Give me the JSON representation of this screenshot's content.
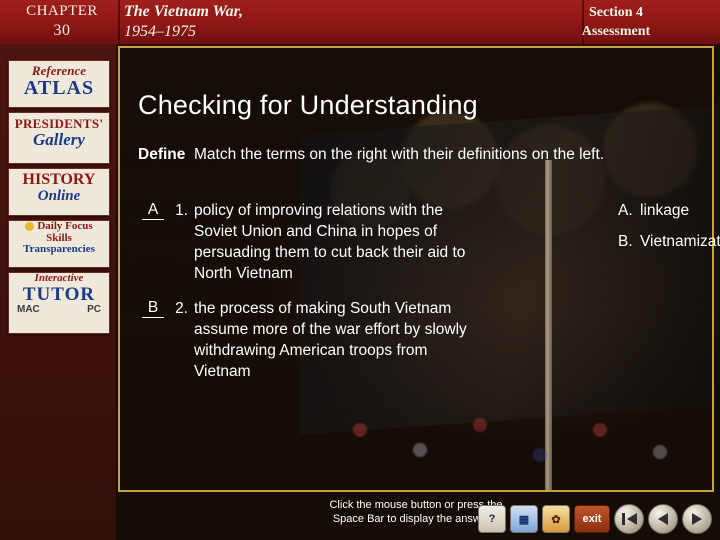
{
  "header": {
    "chapter_label": "CHAPTER",
    "chapter_number": "30",
    "title_line1": "The Vietnam War,",
    "title_line2": "1954–1975",
    "section_line1": "Section 4",
    "section_line2": "Assessment"
  },
  "sidebar": {
    "items": [
      {
        "line1": "Reference",
        "line2": "ATLAS"
      },
      {
        "line1": "PRESIDENTS'",
        "line2": "Gallery"
      },
      {
        "line1": "HISTORY",
        "line2": "Online"
      },
      {
        "line1": "Daily Focus",
        "line2": "Skills",
        "line3": "Transparencies"
      },
      {
        "line1": "Interactive",
        "line2": "TUTOR",
        "line3": "MAC",
        "line4": "PC"
      }
    ]
  },
  "main": {
    "page_title": "Checking for Understanding",
    "directions_label": "Define",
    "directions_text": "Match the terms on the right with their definitions on the left.",
    "questions": [
      {
        "answer": "A",
        "number": "1.",
        "text": "policy of improving relations with the Soviet Union and China in hopes of persuading them to cut back their aid to North Vietnam"
      },
      {
        "answer": "B",
        "number": "2.",
        "text": "the process of making South Vietnam assume more of the war effort by slowly withdrawing American troops from Vietnam"
      }
    ],
    "choices": [
      {
        "letter": "A.",
        "term": "linkage"
      },
      {
        "letter": "B.",
        "term": "Vietnamization"
      }
    ],
    "footer_line1": "Click the mouse button or press the",
    "footer_line2": "Space Bar to display the answers."
  },
  "navbar": {
    "buttons": [
      {
        "name": "help-icon",
        "label": "?"
      },
      {
        "name": "chart-icon",
        "label": "▦"
      },
      {
        "name": "gallery-icon",
        "label": "✿"
      },
      {
        "name": "exit-button",
        "label": "exit"
      },
      {
        "name": "previous-button",
        "label": "◀"
      },
      {
        "name": "back-button",
        "label": "◀"
      },
      {
        "name": "next-button",
        "label": "▶"
      }
    ]
  },
  "colors": {
    "header_red": "#8d1714",
    "gold_border": "#c9a23c",
    "text_white": "#ffffff"
  }
}
